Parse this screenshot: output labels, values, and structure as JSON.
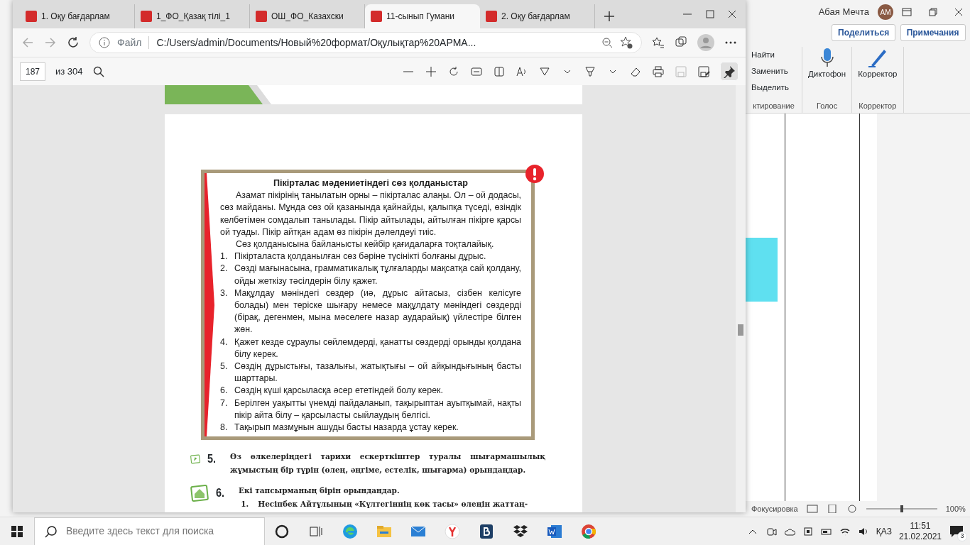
{
  "word_window": {
    "user_name": "Абая Мечта",
    "avatar": "АМ",
    "share_button": "Поделиться",
    "notes_button": "Примечания",
    "editing_items": [
      "Найти",
      "Заменить",
      "Выделить"
    ],
    "groups": [
      {
        "label": "ктирование"
      },
      {
        "label": "Голос",
        "button": "Диктофон"
      },
      {
        "label": "Корректор",
        "button": "Корректор"
      }
    ],
    "status_right": "Фокусировка",
    "zoom": "100%"
  },
  "browser": {
    "tabs": [
      {
        "label": "1. Оқу бағдарлам",
        "selected": false
      },
      {
        "label": "1_ФО_Қазақ тілі_1",
        "selected": false
      },
      {
        "label": "ОШ_ФО_Казахски",
        "selected": false
      },
      {
        "label": "11-сынып Гумани",
        "selected": true
      },
      {
        "label": "2. Оқу бағдарлам",
        "selected": false
      }
    ],
    "address_label": "Файл",
    "url": "C:/Users/admin/Documents/Новый%20формат/Оқулықтар%20АРМА...",
    "page_number": "187",
    "page_total": "из 304"
  },
  "pdf_page": {
    "box_title": "Пікірталас мәдениетіндегі сөз қолданыстар",
    "paragraphs": [
      "Азамат пікірінің танылатын орны – пікірталас алаңы. Ол – ой додасы, сөз майданы. Мұнда сөз ой қазанында қайнайды, қалыпқа түседі, өзіндік келбетімен сомдалып танылады. Пікір айтылады, айтылған пікірге қарсы ой туады. Пікір айтқан адам өз пікірін дәлелдеуі тиіс.",
      "Сөз қолданысына байланысты кейбір қағидаларға тоқталайық."
    ],
    "rules": [
      {
        "number": "1.",
        "text": "Пікірталаста қолданылған сөз бәріне түсінікті болғаны дұрыс."
      },
      {
        "number": "2.",
        "text": "Сөзді мағынасына, грамматикалық тұлғаларды мақсатқа сай қолдану, ойды жеткізу тәсілдерін білу қажет."
      },
      {
        "number": "3.",
        "text": "Мақұлдау мәніндегі сөздер (иә, дұрыс айтасыз, сізбен келісуге болады) мен теріске шығару немесе мақұлдату мәніндегі сөздерді (бірақ, дегенмен, мына мәселеге назар аударайық) үйлестіре білген жөн."
      },
      {
        "number": "4.",
        "text": "Қажет кезде сұраулы сөйлемдерді, қанатты сөздерді орынды қолдана білу керек."
      },
      {
        "number": "5.",
        "text": "Сөздің дұрыстығы, тазалығы, жатықтығы – ой айқындығының басты шарттары."
      },
      {
        "number": "6.",
        "text": "Сөздің күші қарсыласқа әсер ететіндей болу керек."
      },
      {
        "number": "7.",
        "text": "Берілген уақытты үнемді пайдаланып, тақырыптан ауытқымай, нақты пікір айта білу – қарсыласты сыйлаудың белгісі."
      },
      {
        "number": "8.",
        "text": "Тақырып мазмұнын ашуды басты назарда ұстау керек."
      }
    ],
    "tasks": [
      {
        "kind": "pen",
        "number": "5.",
        "text": "Өз өлкелеріңдегі тарихи ескерткіштер туралы шығармашылық жұмыстың бір түрін (өлең, әңгіме, естелік, шығарма) орындаңдар."
      },
      {
        "kind": "home",
        "number": "6.",
        "text": "Екі тапсырманың бірін орындаңдар.",
        "subitem": {
          "number": "1.",
          "text": "Несіпбек Айтұлының «Күлтегіннің көк тасы» өлеңін жаттаң-"
        }
      }
    ]
  },
  "taskbar": {
    "search_placeholder": "Введите здесь текст для поиска",
    "language": "ҚАЗ",
    "time": "11:51",
    "date": "21.02.2021",
    "notifications": "3"
  }
}
